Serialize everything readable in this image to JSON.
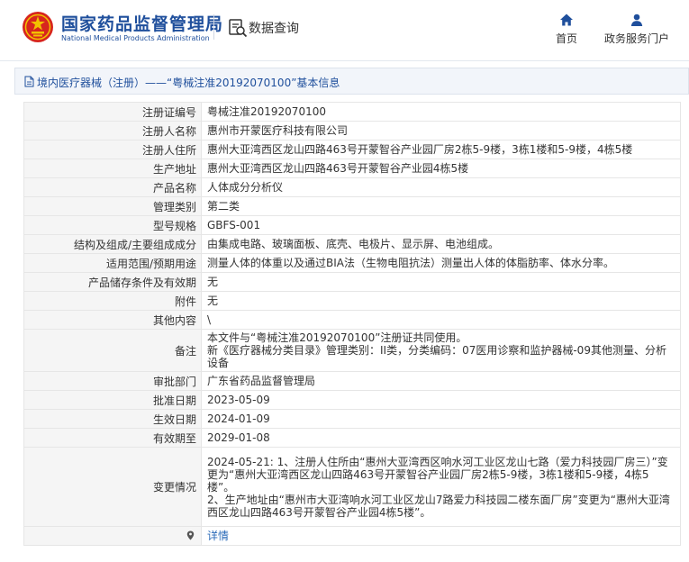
{
  "header": {
    "org_name_cn": "国家药品监督管理局",
    "org_name_en": "National Medical Products Administration",
    "query_title": "数据查询",
    "nav": [
      {
        "label": "首页",
        "icon": "home-icon"
      },
      {
        "label": "政务服务门户",
        "icon": "user-icon"
      }
    ]
  },
  "breadcrumb": {
    "text": "境内医疗器械（注册）——“粤械注准20192070100”基本信息",
    "icon": "document-icon"
  },
  "table": {
    "rows": [
      {
        "label": "注册证编号",
        "value": "粤械注准20192070100"
      },
      {
        "label": "注册人名称",
        "value": "惠州市开蒙医疗科技有限公司"
      },
      {
        "label": "注册人住所",
        "value": "惠州大亚湾西区龙山四路463号开蒙智谷产业园厂房2栋5-9楼，3栋1楼和5-9楼，4栋5楼"
      },
      {
        "label": "生产地址",
        "value": "惠州大亚湾西区龙山四路463号开蒙智谷产业园4栋5楼"
      },
      {
        "label": "产品名称",
        "value": "人体成分分析仪"
      },
      {
        "label": "管理类别",
        "value": "第二类"
      },
      {
        "label": "型号规格",
        "value": "GBFS-001"
      },
      {
        "label": "结构及组成/主要组成成分",
        "value": "由集成电路、玻璃面板、底壳、电极片、显示屏、电池组成。"
      },
      {
        "label": "适用范围/预期用途",
        "value": "测量人体的体重以及通过BIA法（生物电阻抗法）测量出人体的体脂肪率、体水分率。"
      },
      {
        "label": "产品储存条件及有效期",
        "value": "无"
      },
      {
        "label": "附件",
        "value": "无"
      },
      {
        "label": "其他内容",
        "value": "\\"
      },
      {
        "label": "备注",
        "value": "本文件与“粤械注准20192070100”注册证共同使用。\n新《医疗器械分类目录》管理类别：II类，分类编码：07医用诊察和监护器械-09其他测量、分析设备"
      },
      {
        "label": "审批部门",
        "value": "广东省药品监督管理局"
      },
      {
        "label": "批准日期",
        "value": "2023-05-09"
      },
      {
        "label": "生效日期",
        "value": "2024-01-09"
      },
      {
        "label": "有效期至",
        "value": "2029-01-08"
      },
      {
        "label": "变更情况",
        "value": "2024-05-21: 1、注册人住所由“惠州大亚湾西区响水河工业区龙山七路（爱力科技园厂房三）”变更为“惠州大亚湾西区龙山四路463号开蒙智谷产业园厂房2栋5-9楼，3栋1楼和5-9楼，4栋5楼”。\n2、生产地址由“惠州市大亚湾响水河工业区龙山7路爱力科技园二楼东面厂房”变更为“惠州大亚湾西区龙山四路463号开蒙智谷产业园4栋5楼”。"
      }
    ],
    "detail_row": {
      "icon": "pin-icon",
      "link": "详情"
    }
  },
  "colors": {
    "brand_blue": "#1f4f9c",
    "logo_red": "#d7261e",
    "logo_gold": "#f2c200",
    "label_bg": "#f5f5f5",
    "link": "#2a6ab8"
  }
}
